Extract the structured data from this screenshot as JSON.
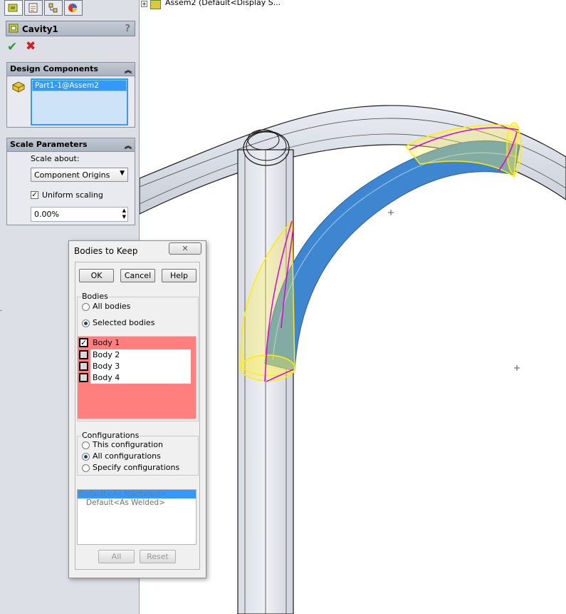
{
  "tree": {
    "top_node": "Assem2  (Default<Display S..."
  },
  "feature": {
    "title": "Cavity1",
    "help": "?"
  },
  "design_components": {
    "title": "Design Components",
    "items": [
      "Part1-1@Assem2"
    ]
  },
  "scale_parameters": {
    "title": "Scale Parameters",
    "scale_about_label": "Scale about:",
    "scale_about_value": "Component Origins",
    "uniform_scaling_label": "Uniform scaling",
    "uniform_scaling_checked": true,
    "scale_value": "0.00%"
  },
  "dialog": {
    "title": "Bodies to Keep",
    "close": "✕",
    "buttons": {
      "ok": "OK",
      "cancel": "Cancel",
      "help": "Help"
    },
    "bodies_group": "Bodies",
    "bodies_options": [
      {
        "label": "All bodies",
        "selected": false
      },
      {
        "label": "Selected bodies",
        "selected": true
      }
    ],
    "bodies": [
      {
        "label": "Body  1",
        "checked": true
      },
      {
        "label": "Body  2",
        "checked": false
      },
      {
        "label": "Body  3",
        "checked": false
      },
      {
        "label": "Body  4",
        "checked": false
      }
    ],
    "configurations_group": "Configurations",
    "config_options": [
      {
        "label": "This configuration",
        "selected": false
      },
      {
        "label": "All configurations",
        "selected": true
      },
      {
        "label": "Specify configurations",
        "selected": false
      }
    ],
    "config_list": [
      "Default<As Machined>",
      "Default<As Welded>"
    ],
    "all_button": "All",
    "reset_button": "Reset"
  },
  "colors": {
    "accent_blue": "#3b7fc9",
    "highlight_red": "#ff7f7f",
    "sketch_yellow": "#ffee00",
    "sketch_magenta": "#dd00dd"
  }
}
